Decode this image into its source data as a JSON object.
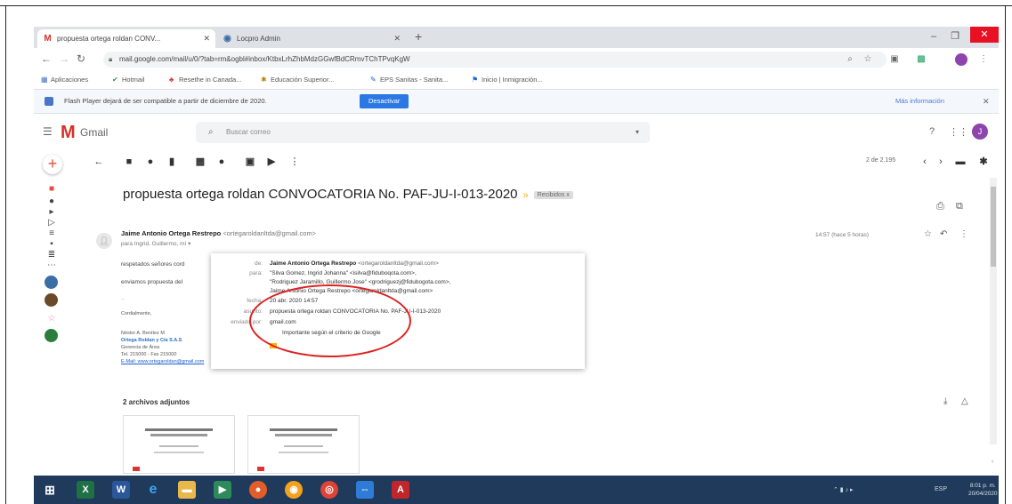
{
  "browser": {
    "tabs": [
      {
        "label": "propuesta ortega roldan CONV...",
        "icon": "gmail-icon"
      },
      {
        "label": "Locpro Admin",
        "icon": "globe-icon"
      }
    ],
    "new_tab": "+",
    "window_controls": {
      "minimize": "–",
      "restore": "❐",
      "close": "✕"
    },
    "url": "mail.google.com/mail/u/0/?tab=rm&ogbl#inbox/KtbxLrhZhbMdzGGwfBdCRmvTChTPvqKgW",
    "bookmarks": [
      {
        "label": "Aplicaciones",
        "icon": "apps-icon"
      },
      {
        "label": "Hotmail",
        "icon": "check-icon"
      },
      {
        "label": "Resethe in Canada...",
        "icon": "leaf-icon"
      },
      {
        "label": "Educación Superior...",
        "icon": "star-icon"
      },
      {
        "label": "EPS Sanitas - Sanita...",
        "icon": "pencil-icon"
      },
      {
        "label": "Inicio | Inmigración...",
        "icon": "flag-icon"
      }
    ]
  },
  "flash_bar": {
    "message": "Flash Player dejará de ser compatible a partir de diciembre de 2020.",
    "button": "Desactivar",
    "more": "Más información",
    "close": "✕"
  },
  "gmail": {
    "logo": "M",
    "name": "Gmail",
    "search_placeholder": "Buscar correo",
    "avatar_letter": "J",
    "pager": "2 de 2.195"
  },
  "message": {
    "subject": "propuesta ortega roldan CONVOCATORIA No. PAF-JU-I-013-2020",
    "label": "Recibidos x",
    "sender_name": "Jaime Antonio Ortega Restrepo",
    "sender_email": "<ortegaroldanltda@gmail.com>",
    "to_line": "para Ingrid, Guillermo, mí ▾",
    "meta": "14:57 (hace 5 horas)",
    "body_lines": [
      "respetados señores cord",
      "enviamos propuesta del"
    ],
    "signature": [
      "Cordialmente,",
      "Néstor A. Benítez M",
      "Ortega Roldan y Cía S.A.S",
      "Gerencia de Área",
      "Tel. 215000 - Fax 215000",
      "E-Mail: www.ortegaroldan@gmail.com"
    ]
  },
  "details_popup": {
    "rows": [
      {
        "label": "de:",
        "value_bold": "Jaime Antonio Ortega Restrepo",
        "value": " <ortegaroldanltda@gmail.com>"
      },
      {
        "label": "para:",
        "value_bold": "",
        "value": "\"Silva Gomez, Ingrid Johanna\" <isilva@fiduboqota.com>,"
      },
      {
        "label": "",
        "value_bold": "",
        "value": "\"Rodriguez Jaramillo, Guillermo Jose\" <grodriguezj@fidubogota.com>,"
      },
      {
        "label": "",
        "value_bold": "",
        "value": "Jaime Antonio Ortega Restrepo <ortegaroldanltda@gmail.com>"
      },
      {
        "label": "fecha:",
        "value_bold": "",
        "value": "20 abr. 2020 14:57"
      },
      {
        "label": "asunto:",
        "value_bold": "",
        "value": "propuesta ortega roldan CONVOCATORIA No. PAF-JU-I-013-2020"
      },
      {
        "label": "enviado por:",
        "value_bold": "",
        "value": "gmail.com"
      },
      {
        "label": "",
        "value_bold": "",
        "value": "Importante según el criterio de Google"
      }
    ]
  },
  "attachments": {
    "title": "2 archivos adjuntos"
  },
  "taskbar": {
    "apps": [
      "windows-icon",
      "excel-icon",
      "word-icon",
      "edge-icon",
      "explorer-icon",
      "media-icon",
      "firefox-icon",
      "app-icon",
      "chrome-icon",
      "teamviewer-icon",
      "acrobat-icon"
    ],
    "tray_lang": "ESP",
    "time": "8:01 p. m.",
    "date": "20/04/2020"
  },
  "colors": {
    "gmail_red": "#d93025",
    "flash_button": "#2b78e4",
    "annotation_circle": "#dd2222",
    "taskbar": "#1f3a5a"
  }
}
